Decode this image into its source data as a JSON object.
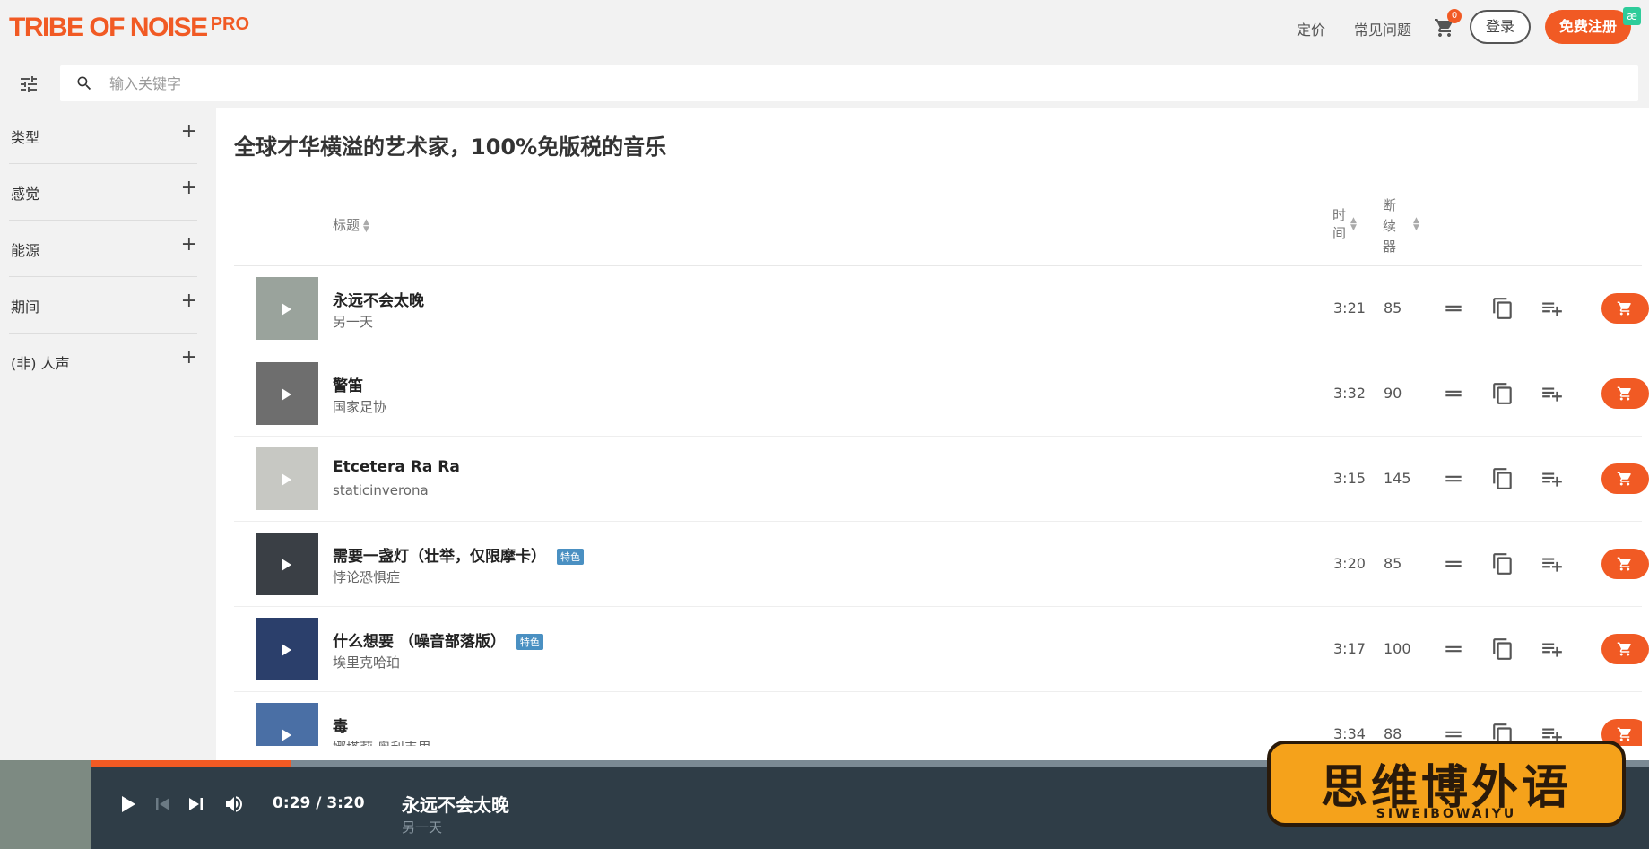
{
  "header": {
    "logo": "TRIBE OF NOISE",
    "logo_pro": "PRO",
    "nav": {
      "pricing": "定价",
      "faq": "常见问题"
    },
    "cart_count": "0",
    "login": "登录",
    "signup": "免费注册",
    "corner_badge": "æ"
  },
  "search": {
    "placeholder": "输入关键字"
  },
  "sidebar": {
    "filters": [
      {
        "label": "类型"
      },
      {
        "label": "感觉"
      },
      {
        "label": "能源"
      },
      {
        "label": "期间"
      },
      {
        "label": "(非) 人声"
      }
    ]
  },
  "main": {
    "title": "全球才华横溢的艺术家，100%免版税的音乐",
    "columns": {
      "title": "标题",
      "time_line1": "时",
      "time_line2": "间",
      "bpm_line1": "断",
      "bpm_line2": "续",
      "bpm_line3": "器"
    },
    "tracks": [
      {
        "title": "永远不会太晚",
        "artist": "另一天",
        "time": "3:21",
        "bpm": "85",
        "tag": "",
        "thumb_color": "#9aa39c"
      },
      {
        "title": "警笛",
        "artist": "国家足协",
        "time": "3:32",
        "bpm": "90",
        "tag": "",
        "thumb_color": "#6e6e6e"
      },
      {
        "title": "Etcetera Ra Ra",
        "artist": "staticinverona",
        "time": "3:15",
        "bpm": "145",
        "tag": "",
        "thumb_color": "#c7c8c3"
      },
      {
        "title": "需要一盏灯（壮举，仅限摩卡）",
        "artist": "悖论恐惧症",
        "time": "3:20",
        "bpm": "85",
        "tag": "特色",
        "thumb_color": "#3a3f45"
      },
      {
        "title": "什么想要 （噪音部落版）",
        "artist": "埃里克哈珀",
        "time": "3:17",
        "bpm": "100",
        "tag": "特色",
        "thumb_color": "#2b3f6b"
      },
      {
        "title": "毒",
        "artist": "娜塔莉·奥利韦里",
        "time": "3:34",
        "bpm": "88",
        "tag": "",
        "thumb_color": "#4a6fa5"
      }
    ]
  },
  "player": {
    "time": "0:29 / 3:20",
    "title": "永远不会太晚",
    "artist": "另一天",
    "progress": 0.128
  },
  "watermark": {
    "main": "思维博外语",
    "sub": "SIWEIBOWAIYU"
  },
  "colors": {
    "accent": "#f15a24",
    "player_bg": "#2f3d47",
    "tag": "#4a90c2"
  }
}
